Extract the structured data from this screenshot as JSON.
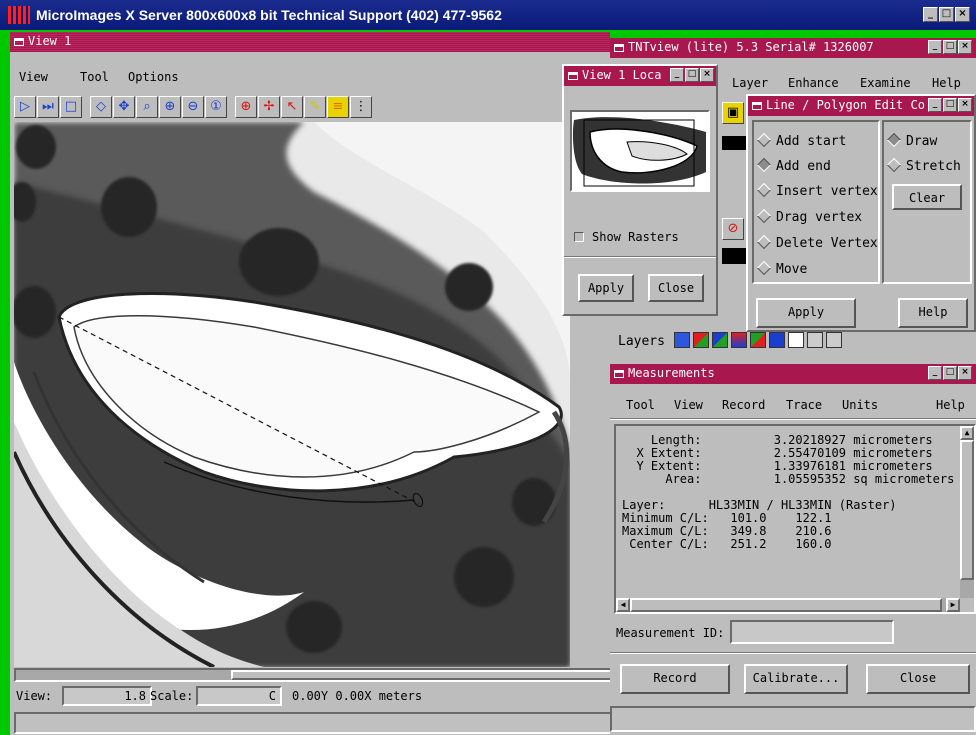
{
  "server": {
    "title": "MicroImages X Server  800x600x8 bit  Technical Support (402) 477-9562"
  },
  "view1": {
    "title": "View 1",
    "menu": [
      "View",
      "Tool",
      "Options"
    ],
    "status": {
      "view_label": "View:",
      "view_value": "1.8",
      "scale_label": "Scale:",
      "scale_value": "C",
      "coords": "0.00Y 0.00X meters"
    }
  },
  "locator": {
    "title": "View 1 Loca",
    "show_rasters": "Show Rasters",
    "apply": "Apply",
    "close": "Close"
  },
  "tntview": {
    "title": "TNTview (lite) 5.3  Serial# 1326007",
    "menu": [
      "Layer",
      "Enhance",
      "Examine",
      "Help"
    ],
    "layers_label": "Layers"
  },
  "line_edit": {
    "title": "Line / Polygon Edit Co",
    "options": [
      "Add start",
      "Add end",
      "Insert vertex",
      "Drag vertex",
      "Delete Vertex",
      "Move"
    ],
    "modes": [
      "Draw",
      "Stretch"
    ],
    "clear": "Clear",
    "apply": "Apply",
    "help": "Help"
  },
  "measurements": {
    "title": "Measurements",
    "menu": [
      "Tool",
      "View",
      "Record",
      "Trace",
      "Units",
      "Help"
    ],
    "lines": [
      "    Length:          3.20218927 micrometers",
      "  X Extent:          2.55470109 micrometers",
      "  Y Extent:          1.33976181 micrometers",
      "      Area:          1.05595352 sq micrometers",
      "",
      "Layer:      HL33MIN / HL33MIN (Raster)",
      "Minimum C/L:   101.0    122.1",
      "Maximum C/L:   349.8    210.6",
      " Center C/L:   251.2    160.0"
    ],
    "id_label": "Measurement ID:",
    "id_value": "",
    "record": "Record",
    "calibrate": "Calibrate...",
    "close": "Close"
  },
  "colors": {
    "desktop": "#00c800",
    "title_active": "#0a1a78",
    "title_window": "#a8184e",
    "motif_gray": "#bdbdbd"
  }
}
